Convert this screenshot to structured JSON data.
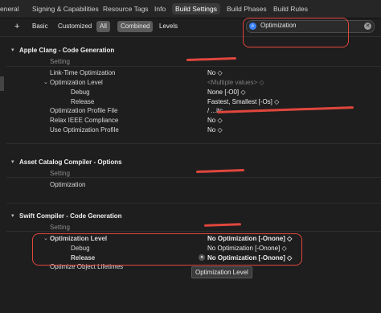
{
  "tabs": [
    "eneral",
    "Signing & Capabilities",
    "Resource Tags",
    "Info",
    "Build Settings",
    "Build Phases",
    "Build Rules"
  ],
  "filters": {
    "add": "+",
    "basic": "Basic",
    "customized": "Customized",
    "all": "All",
    "combined": "Combined",
    "levels": "Levels"
  },
  "search": {
    "value": "Optimization",
    "search_icon": "search-icon",
    "clear_icon": "clear-icon"
  },
  "apple_clang": {
    "title": "Apple Clang - Code Generation",
    "setting_header": "Setting",
    "rows": {
      "lto": {
        "label": "Link-Time Optimization",
        "value": "No ◇"
      },
      "opt": {
        "label": "Optimization Level",
        "value": "<Multiple values> ◇"
      },
      "opt_debug": {
        "label": "Debug",
        "value": "None [-O0] ◇"
      },
      "opt_release": {
        "label": "Release",
        "value": "Fastest, Smallest [-Os] ◇"
      },
      "profile": {
        "label": "Optimization Profile File",
        "value": "/ ...itc..."
      },
      "ieee": {
        "label": "Relax IEEE Compliance",
        "value": "No ◇"
      },
      "useopt": {
        "label": "Use Optimization Profile",
        "value": "No ◇"
      }
    }
  },
  "asset_catalog": {
    "title": "Asset Catalog Compiler - Options",
    "setting_header": "Setting",
    "row_label": "Optimization"
  },
  "swift": {
    "title": "Swift Compiler - Code Generation",
    "setting_header": "Setting",
    "rows": {
      "opt": {
        "label": "Optimization Level",
        "value": "No Optimization [-Onone] ◇"
      },
      "opt_debug": {
        "label": "Debug",
        "value": "No Optimization [-Onone] ◇"
      },
      "opt_release": {
        "label": "Release",
        "value": "No Optimization [-Onone] ◇"
      },
      "objlife": {
        "label": "Optimize Object Lifetimes"
      }
    },
    "tooltip": "Optimization Level"
  },
  "colors": {
    "accent": "#3a82f7",
    "annotation": "#e0463d"
  }
}
